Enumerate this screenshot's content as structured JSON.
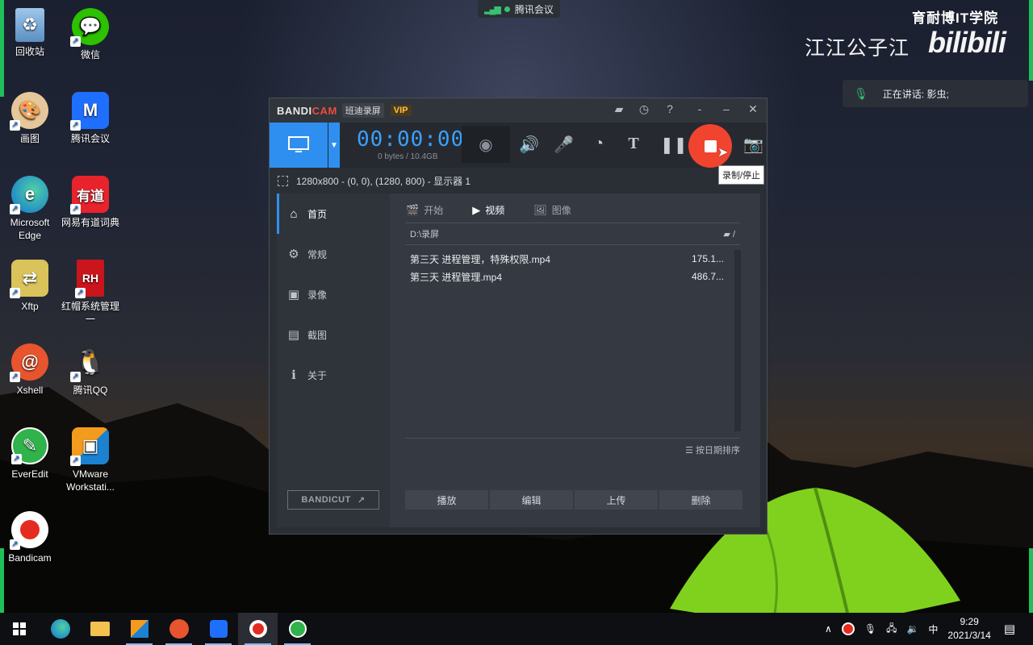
{
  "desktop_icons": [
    {
      "label": "回收站",
      "icon": "recycle-bin-icon"
    },
    {
      "label": "微信",
      "icon": "wechat-icon"
    },
    {
      "label": "画图",
      "icon": "paint-icon"
    },
    {
      "label": "腾讯会议",
      "icon": "tencent-meeting-icon"
    },
    {
      "label": "Microsoft Edge",
      "icon": "edge-icon"
    },
    {
      "label": "网易有道词典",
      "icon": "youdao-icon"
    },
    {
      "label": "Xftp",
      "icon": "xftp-icon"
    },
    {
      "label": "红帽系统管理一",
      "icon": "redhat-icon"
    },
    {
      "label": "Xshell",
      "icon": "xshell-icon"
    },
    {
      "label": "腾讯QQ",
      "icon": "qq-icon"
    },
    {
      "label": "EverEdit",
      "icon": "everedit-icon"
    },
    {
      "label": "VMware Workstati...",
      "icon": "vmware-icon"
    },
    {
      "label": "Bandicam",
      "icon": "bandicam-icon"
    }
  ],
  "overlay": {
    "meeting_label": "腾讯会议",
    "watermark_top": "育耐博IT学院",
    "watermark_name": "江江公子江",
    "watermark_site": "bilibili",
    "speaking_text": "正在讲话: 影虫;"
  },
  "bandicam": {
    "logo_a": "BANDI",
    "logo_b": "CAM",
    "cn_name": "班迪录屏",
    "vip": "VIP",
    "timer": "00:00:00",
    "bytes": "0 bytes / 10.4GB",
    "tooltip": "录制/停止",
    "region": "1280x800 - (0, 0), (1280, 800) - 显示器 1",
    "sidebar": [
      "首页",
      "常规",
      "录像",
      "截图",
      "关于"
    ],
    "tabs": [
      "开始",
      "视频",
      "图像"
    ],
    "path": "D:\\录屏",
    "path_btn": "/",
    "files": [
      {
        "name": "第三天 进程管理，特殊权限.mp4",
        "size": "175.1..."
      },
      {
        "name": "第三天 进程管理.mp4",
        "size": "486.7..."
      }
    ],
    "sort": "按日期排序",
    "actions": [
      "播放",
      "编辑",
      "上传",
      "删除"
    ],
    "bandicut": "BANDICUT"
  },
  "taskbar": {
    "ime": "中",
    "time": "9:29",
    "date": "2021/3/14"
  },
  "colors": {
    "accent": "#2f8ff0",
    "record": "#f0442f",
    "timer": "#3aa0ff"
  }
}
